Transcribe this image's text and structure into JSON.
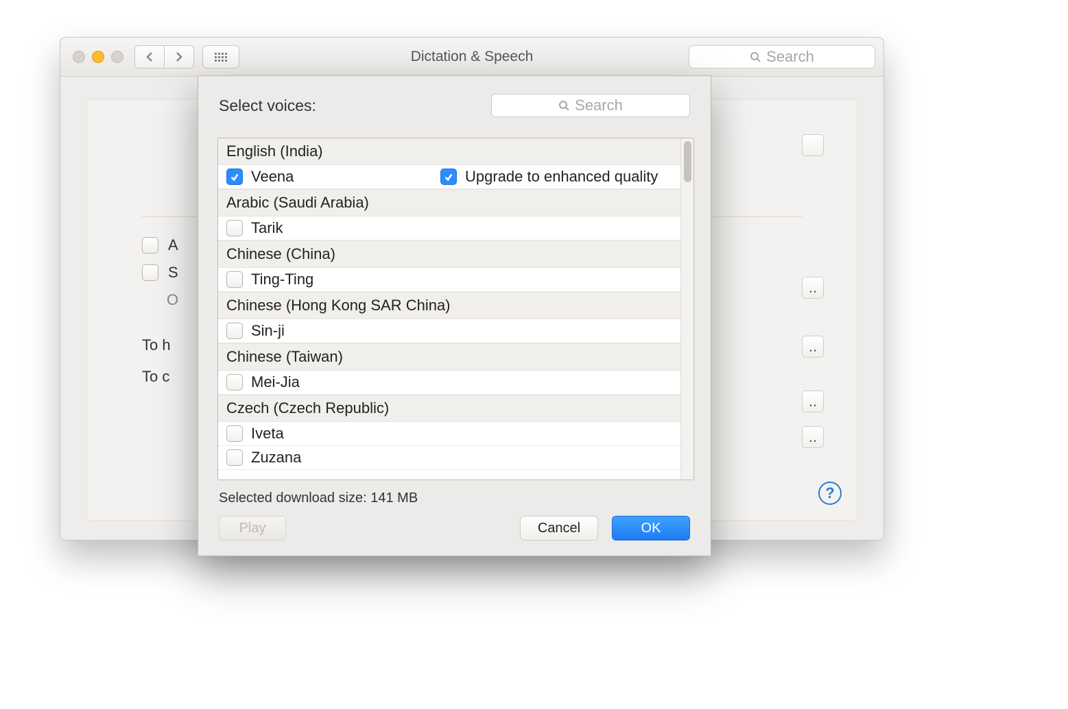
{
  "window": {
    "title": "Dictation & Speech",
    "search_placeholder": "Search"
  },
  "background": {
    "opt1_label": "A",
    "opt2_label": "S",
    "opt3_label": "O",
    "hint1": "To h",
    "hint2": "To c",
    "help_label": "?"
  },
  "dialog": {
    "heading": "Select voices:",
    "search_placeholder": "Search",
    "download_text": "Selected download size: 141 MB",
    "play_label": "Play",
    "cancel_label": "Cancel",
    "ok_label": "OK",
    "upgrade_label": "Upgrade to enhanced quality",
    "groups": [
      {
        "header": "English (India)",
        "voices": [
          {
            "name": "Veena",
            "checked": true,
            "upgrade_checked": true
          }
        ]
      },
      {
        "header": "Arabic (Saudi Arabia)",
        "voices": [
          {
            "name": "Tarik",
            "checked": false
          }
        ]
      },
      {
        "header": "Chinese (China)",
        "voices": [
          {
            "name": "Ting-Ting",
            "checked": false
          }
        ]
      },
      {
        "header": "Chinese (Hong Kong SAR China)",
        "voices": [
          {
            "name": "Sin-ji",
            "checked": false
          }
        ]
      },
      {
        "header": "Chinese (Taiwan)",
        "voices": [
          {
            "name": "Mei-Jia",
            "checked": false
          }
        ]
      },
      {
        "header": "Czech (Czech Republic)",
        "voices": [
          {
            "name": "Iveta",
            "checked": false
          },
          {
            "name": "Zuzana",
            "checked": false
          }
        ]
      }
    ]
  }
}
